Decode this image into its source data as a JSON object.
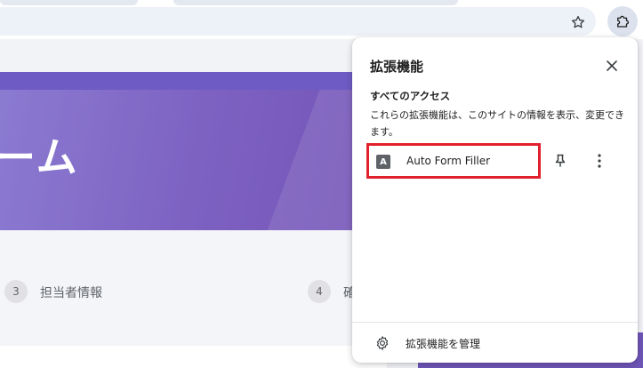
{
  "toolbar": {
    "bookmark_icon": "star-icon",
    "extensions_icon": "puzzle-icon"
  },
  "page": {
    "banner_title": "ーム",
    "steps": [
      {
        "number": "3",
        "label": "担当者情報"
      },
      {
        "number": "4",
        "label": "確"
      }
    ]
  },
  "extensions_popup": {
    "title": "拡張機能",
    "close_icon": "close-icon",
    "section_title": "すべてのアクセス",
    "section_description": "これらの拡張機能は、このサイトの情報を表示、変更できます。",
    "extensions": [
      {
        "icon_letter": "A",
        "name": "Auto Form Filler",
        "pin_icon": "pin-icon",
        "more_icon": "more-vert-icon"
      }
    ],
    "manage_label": "拡張機能を管理",
    "manage_icon": "gear-icon",
    "highlight_color": "#e0202c"
  }
}
